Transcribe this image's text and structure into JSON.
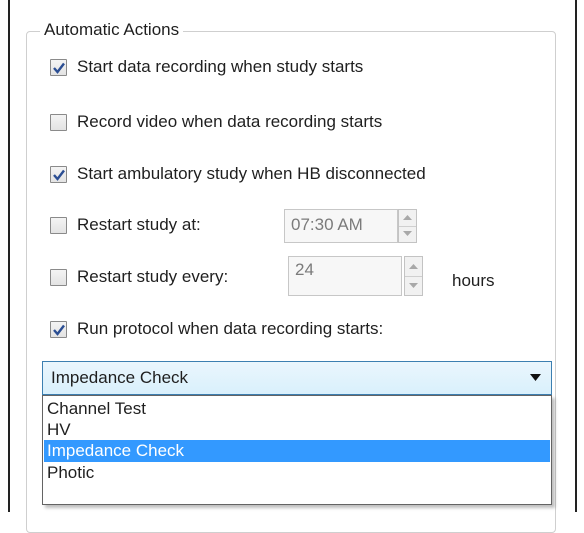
{
  "group": {
    "title": "Automatic Actions"
  },
  "options": {
    "start_recording": {
      "label": "Start data recording when study starts",
      "checked": true
    },
    "record_video": {
      "label": "Record video when data recording starts",
      "checked": false
    },
    "start_ambulatory": {
      "label": "Start ambulatory study when HB disconnected",
      "checked": true
    },
    "restart_at": {
      "label": "Restart study at:",
      "checked": false,
      "value": "07:30 AM"
    },
    "restart_every": {
      "label": "Restart study every:",
      "checked": false,
      "value": "24",
      "unit": "hours"
    },
    "run_protocol": {
      "label": "Run protocol when data recording starts:",
      "checked": true
    }
  },
  "protocol_select": {
    "value": "Impedance Check",
    "options": [
      "Channel Test",
      "HV",
      "Impedance Check",
      "Photic"
    ],
    "selected_index": 2
  },
  "colors": {
    "selection": "#3399ff",
    "check": "#2b4e93"
  },
  "icons": {
    "check": "checkmark-icon",
    "spin_up": "spin-up-icon",
    "spin_down": "spin-down-icon",
    "dropdown": "chevron-down-icon"
  }
}
